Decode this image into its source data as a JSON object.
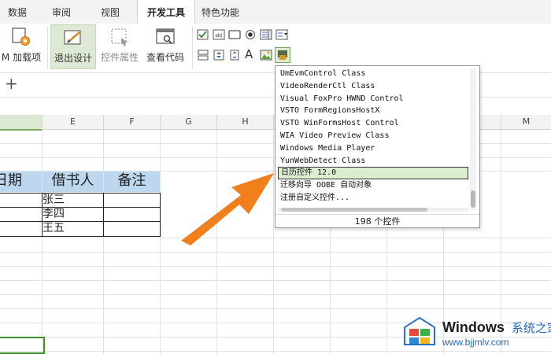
{
  "tabs": [
    {
      "label": "数据",
      "active": false
    },
    {
      "label": "审阅",
      "active": false
    },
    {
      "label": "视图",
      "active": false
    },
    {
      "label": "开发工具",
      "active": true
    },
    {
      "label": "特色功能",
      "active": false
    }
  ],
  "ribbon": {
    "com_addins_label": "M 加载项",
    "exit_design_label": "退出设计",
    "control_props_label": "控件属性",
    "view_code_label": "查看代码",
    "text_tool_glyph": "A"
  },
  "subbar": {
    "add_sheet_glyph": "+"
  },
  "columns": [
    "E",
    "F",
    "G",
    "H",
    "M"
  ],
  "table": {
    "headers": [
      "日期",
      "借书人",
      "备注"
    ],
    "borrowers": [
      "张三",
      "李四",
      "王五"
    ]
  },
  "control_list": {
    "items": [
      "UmEvmControl Class",
      "VideoRenderCtl Class",
      "Visual FoxPro HWND Control",
      "VSTO FormRegionsHostX",
      "VSTO WinFormsHost Control",
      "WIA Video Preview Class",
      "Windows Media Player",
      "YunWebDetect Class",
      "日历控件 12.0",
      "迁移向导 OOBE 自动对象",
      "注册自定义控件..."
    ],
    "selected_index": 8,
    "count_label": "198 个控件"
  },
  "watermark": {
    "brand": "Windows",
    "suffix": "系统之家",
    "url": "www.bjjmlv.com"
  },
  "colors": {
    "header_fill": "#bdd7ee",
    "selected_item": "#dbeed2",
    "arrow": "#f07f1c",
    "active_column": "#dce8d2"
  }
}
